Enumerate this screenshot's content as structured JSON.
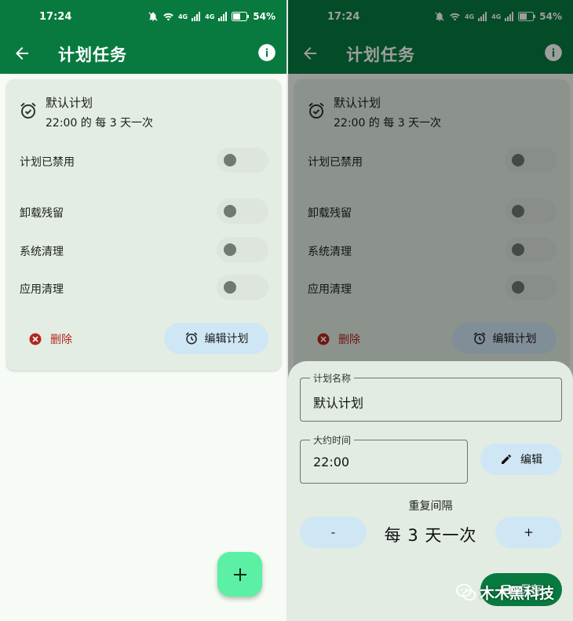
{
  "colors": {
    "primary": "#087a3f",
    "card": "#e3ede4",
    "tonal": "#cfe6f5",
    "danger": "#b3261e",
    "fab": "#5cf0a4"
  },
  "status_bar": {
    "time": "17:24",
    "net_a": "4G",
    "net_b": "4G",
    "battery": "54%"
  },
  "appbar": {
    "title": "计划任务",
    "back_icon": "arrow-back-icon",
    "info_icon": "info-icon"
  },
  "card": {
    "plan_name": "默认计划",
    "plan_desc": "22:00 的 每 3 天一次",
    "toggles": [
      {
        "label": "计划已禁用",
        "on": false
      },
      {
        "label": "卸载残留",
        "on": false
      },
      {
        "label": "系统清理",
        "on": false
      },
      {
        "label": "应用清理",
        "on": false
      }
    ],
    "delete_label": "删除",
    "edit_plan_label": "编辑计划"
  },
  "fab": {
    "icon": "plus-icon"
  },
  "sheet": {
    "name_label": "计划名称",
    "name_value": "默认计划",
    "time_label": "大约时间",
    "time_value": "22:00",
    "edit_label": "编辑",
    "repeat_label": "重复间隔",
    "minus_label": "-",
    "repeat_value": "每 3 天一次",
    "plus_label": "+",
    "save_label": "保存"
  },
  "watermark": {
    "text": "木木黑科技"
  }
}
